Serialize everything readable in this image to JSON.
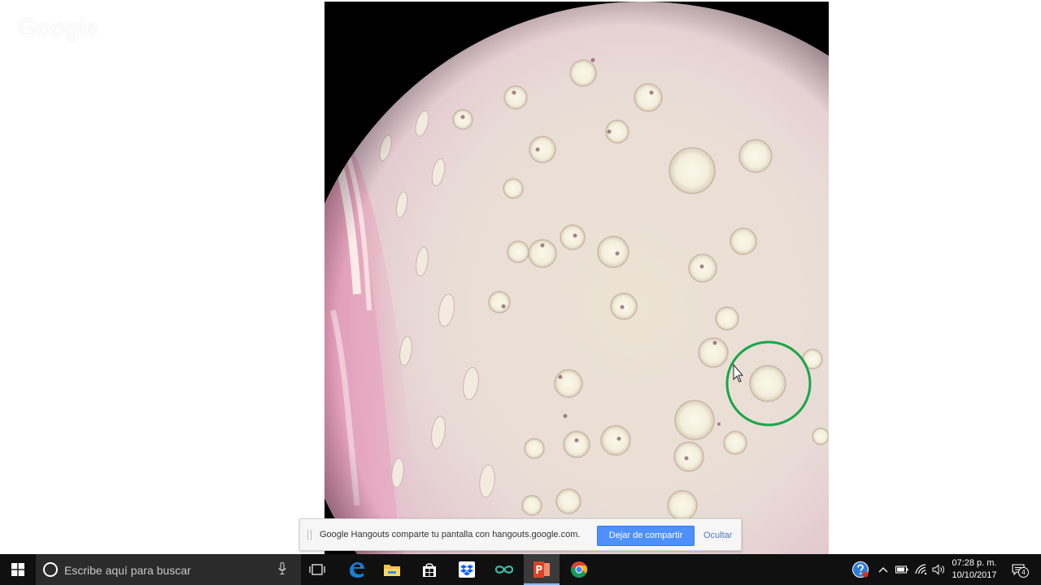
{
  "watermark": {
    "text": "Google"
  },
  "sharebar": {
    "message": "Google Hangouts comparte tu pantalla con hangouts.google.com.",
    "stop_label": "Dejar de compartir",
    "hide_label": "Ocultar"
  },
  "taskbar": {
    "search_placeholder": "Escribe aquí para buscar",
    "apps": [
      {
        "name": "edge-icon",
        "color": "#1e7bd6"
      },
      {
        "name": "file-explorer-icon",
        "color": "#f4c23e"
      },
      {
        "name": "store-icon",
        "color": "#ffffff"
      },
      {
        "name": "dropbox-icon",
        "color": "#0061fe"
      },
      {
        "name": "infinity-app-icon",
        "color": "#3fb8a7"
      },
      {
        "name": "powerpoint-icon",
        "color": "#d24726"
      },
      {
        "name": "chrome-icon",
        "color": "#4285f4"
      }
    ],
    "clock": {
      "time": "07:28 p. m.",
      "date": "10/10/2017"
    },
    "notification_count": "4"
  },
  "colors": {
    "annotation_circle": "#1aa64a",
    "share_button": "#4d90fe"
  }
}
